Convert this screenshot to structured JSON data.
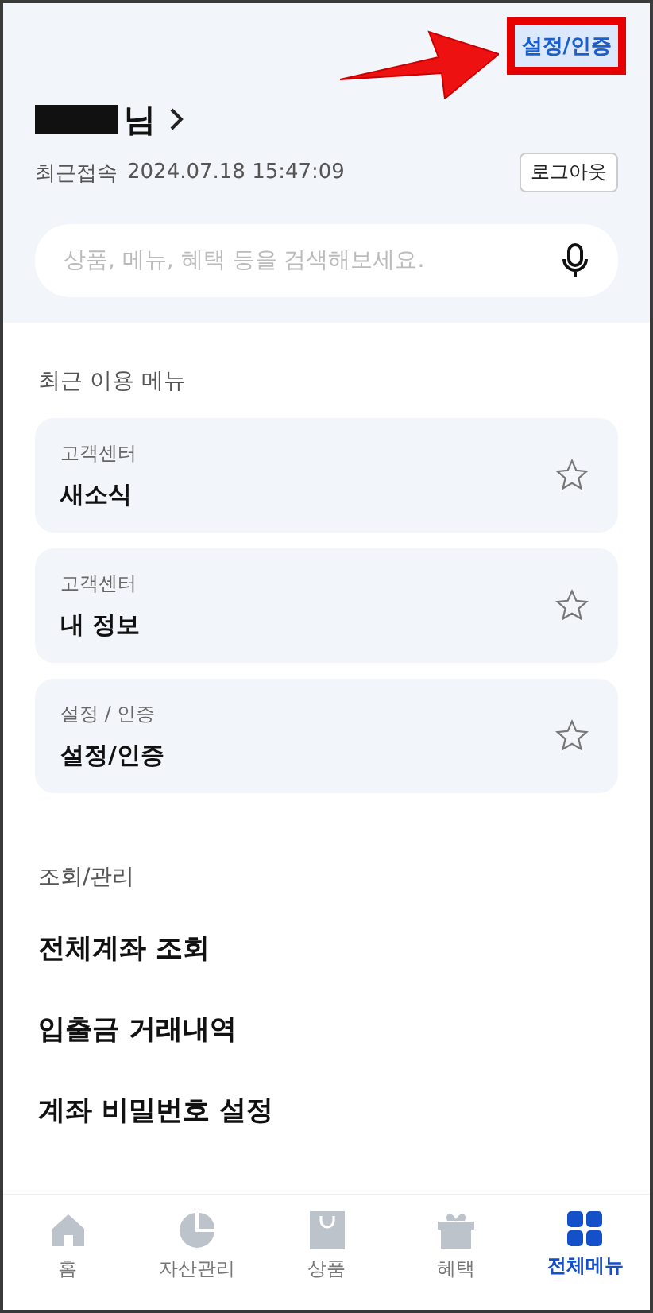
{
  "header": {
    "settings_button": "설정/인증",
    "highlighted": true,
    "name_suffix": "님",
    "last_login_label": "최근접속",
    "last_login_time": "2024.07.18 15:47:09",
    "logout_button": "로그아웃"
  },
  "search": {
    "placeholder": "상품, 메뉴, 혜택 등을 검색해보세요."
  },
  "recent": {
    "title": "최근 이용 메뉴",
    "items": [
      {
        "category": "고객센터",
        "name": "새소식",
        "favorite": false
      },
      {
        "category": "고객센터",
        "name": "내 정보",
        "favorite": false
      },
      {
        "category": "설정 / 인증",
        "name": "설정/인증",
        "favorite": false
      }
    ]
  },
  "section": {
    "title": "조회/관리",
    "items": [
      "전체계좌 조회",
      "입출금 거래내역",
      "계좌 비밀번호 설정"
    ]
  },
  "nav": [
    {
      "label": "홈",
      "kind": "home",
      "selected": false
    },
    {
      "label": "자산관리",
      "kind": "assets",
      "selected": false
    },
    {
      "label": "상품",
      "kind": "products",
      "selected": false
    },
    {
      "label": "혜택",
      "kind": "benefits",
      "selected": false
    },
    {
      "label": "전체메뉴",
      "kind": "menu",
      "selected": true
    }
  ]
}
